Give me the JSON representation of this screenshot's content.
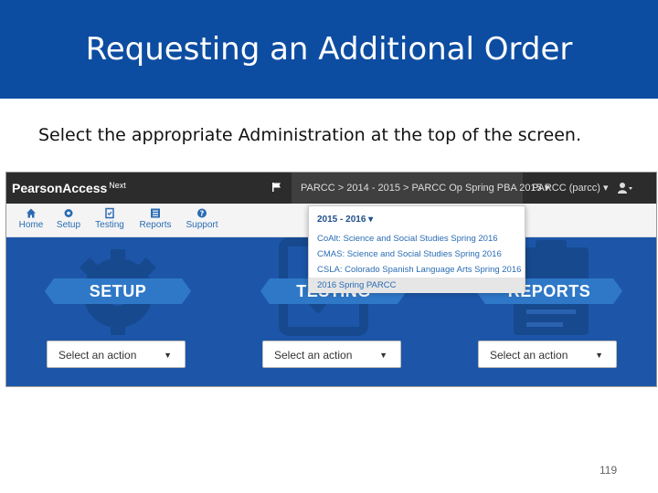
{
  "slide": {
    "title": "Requesting an Additional Order",
    "instruction": "Select the appropriate Administration at the top of the screen.",
    "page_number": "119"
  },
  "app": {
    "brand": "PearsonAccess",
    "brand_super": "Next",
    "breadcrumb": "PARCC > 2014 - 2015 > PARCC Op Spring PBA 2015 ▾",
    "org": "PARCC (parcc) ▾"
  },
  "nav": {
    "items": [
      {
        "label": "Home",
        "icon": "home-icon"
      },
      {
        "label": "Setup",
        "icon": "gear-icon"
      },
      {
        "label": "Testing",
        "icon": "checklist-icon"
      },
      {
        "label": "Reports",
        "icon": "list-icon"
      },
      {
        "label": "Support",
        "icon": "question-icon"
      }
    ]
  },
  "cards": [
    {
      "banner": "SETUP",
      "select": "Select an action",
      "icon": "gear-icon"
    },
    {
      "banner": "TESTING",
      "select": "Select an action",
      "icon": "checklist-icon"
    },
    {
      "banner": "REPORTS",
      "select": "Select an action",
      "icon": "clipboard-icon"
    }
  ],
  "dropdown": {
    "header": "2015 - 2016 ▾",
    "items": [
      "CoAlt: Science and Social Studies Spring 2016",
      "CMAS: Science and Social Studies Spring 2016",
      "CSLA: Colorado Spanish Language Arts Spring 2016",
      "2016 Spring PARCC"
    ],
    "active_index": 3
  },
  "colors": {
    "title_bar": "#0d4da1",
    "app_blue": "#1d56a8",
    "banner": "#2f78c8",
    "topbar": "#2c2c2c"
  }
}
